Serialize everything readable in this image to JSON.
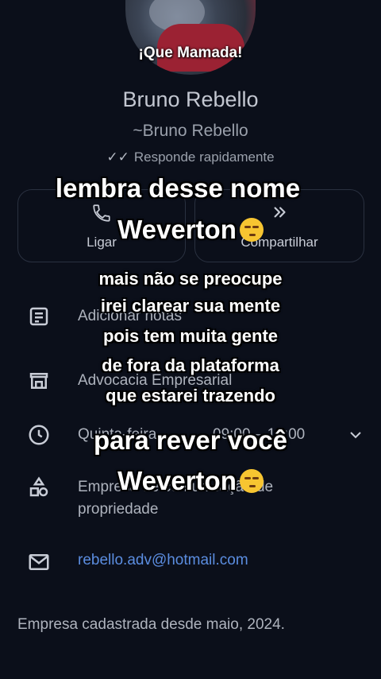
{
  "profile": {
    "avatar_caption": "¡Que Mamada!",
    "name": "Bruno Rebello",
    "push_name": "~Bruno Rebello",
    "status": "Responde rapidamente"
  },
  "actions": {
    "call_label": "Ligar",
    "share_label": "Compartilhar"
  },
  "details": {
    "notes": "Adicionar notas",
    "category": "Advocacia Empresarial",
    "hours_day": "Quinta-feira",
    "hours_time": "09:00 – 18:00",
    "description_line1": "Empresa de comunicação de",
    "description_line2": "propriedade",
    "email": "rebello.adv@hotmail.com"
  },
  "footer": "Empresa cadastrada desde maio, 2024.",
  "overlay": {
    "line1": "lembra desse nome",
    "line2": "Weverton",
    "line3": "mais não se preocupe",
    "line4": "irei clarear sua mente",
    "line5": "pois tem muita gente",
    "line6": "de fora da plataforma",
    "line7": "que estarei trazendo",
    "line8": "para rever você",
    "line9": "Weverton"
  },
  "icons": {
    "check": "double-check-icon",
    "call": "phone-icon",
    "share": "forward-icon",
    "notes": "note-icon",
    "store": "store-icon",
    "clock": "clock-icon",
    "category": "shapes-icon",
    "mail": "mail-icon",
    "chevron": "chevron-down-icon"
  },
  "colors": {
    "background": "#0b0f1a",
    "email_link": "#5b8de0",
    "card_border": "#2a3140"
  }
}
